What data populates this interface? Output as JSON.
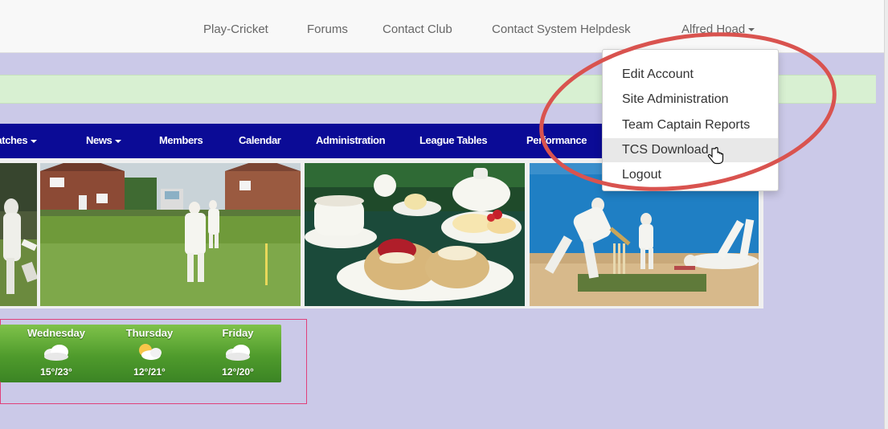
{
  "topnav": {
    "links": [
      "Play-Cricket",
      "Forums",
      "Contact Club",
      "Contact System Helpdesk"
    ],
    "user_name": "Alfred Hoad"
  },
  "user_menu": {
    "items": [
      "Edit Account",
      "Site Administration",
      "Team Captain Reports",
      "TCS Download",
      "Logout"
    ],
    "hovered": "TCS Download"
  },
  "mainnav": {
    "items": [
      "Matches",
      "News",
      "Members",
      "Calendar",
      "Administration",
      "League Tables",
      "Performance"
    ]
  },
  "weather": {
    "days": [
      {
        "name": "Wednesday",
        "temp": "15°/23°",
        "icon": "cloud-icon"
      },
      {
        "name": "Thursday",
        "temp": "12°/21°",
        "icon": "sun-cloud-icon"
      },
      {
        "name": "Friday",
        "temp": "12°/20°",
        "icon": "cloud-icon"
      }
    ]
  },
  "colors": {
    "navbar": "#0b0b96",
    "page_background": "#cbc9e8",
    "annotation": "#d9534f",
    "weather_green": "#4f9b2c",
    "weather_border": "#e0407a"
  }
}
